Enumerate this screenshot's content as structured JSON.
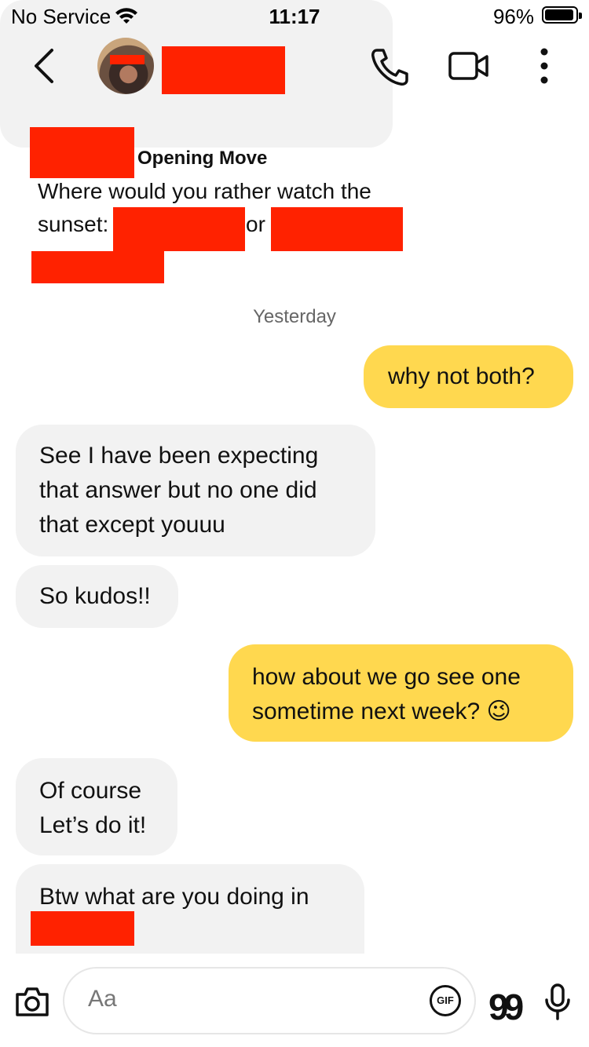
{
  "status_bar": {
    "carrier": "No Service",
    "time": "11:17",
    "battery_percent": "96%",
    "battery_level": 0.96
  },
  "header": {
    "back_icon": "chevron-left-icon",
    "call_icon": "phone-icon",
    "video_icon": "video-camera-icon",
    "more_icon": "more-vertical-icon"
  },
  "opening_move": {
    "title": "Opening Move",
    "question_line1": "Where would you rather watch the",
    "question_line2": "sunset:",
    "or_text": "or"
  },
  "date_separator": "Yesterday",
  "messages": [
    {
      "dir": "out",
      "lines": [
        "why not both?"
      ]
    },
    {
      "dir": "in",
      "lines": [
        "See I have been expecting",
        "that answer but no one did",
        "that except youuu"
      ]
    },
    {
      "dir": "in",
      "lines": [
        "So kudos!!"
      ]
    },
    {
      "dir": "out",
      "lines": [
        "how about we go see one",
        "sometime next week? 😉"
      ]
    },
    {
      "dir": "in",
      "lines": [
        "Of course",
        "Let’s do it!"
      ]
    },
    {
      "dir": "in",
      "lines": [
        "Btw what are you doing in"
      ]
    }
  ],
  "composer": {
    "placeholder": "Aa",
    "gif_label": "GIF",
    "quote_glyph": "99",
    "camera_icon": "camera-icon",
    "mic_icon": "microphone-icon"
  },
  "colors": {
    "outgoing_bubble": "#ffd84f",
    "incoming_bubble": "#f2f2f2",
    "redaction": "#ff2200"
  }
}
